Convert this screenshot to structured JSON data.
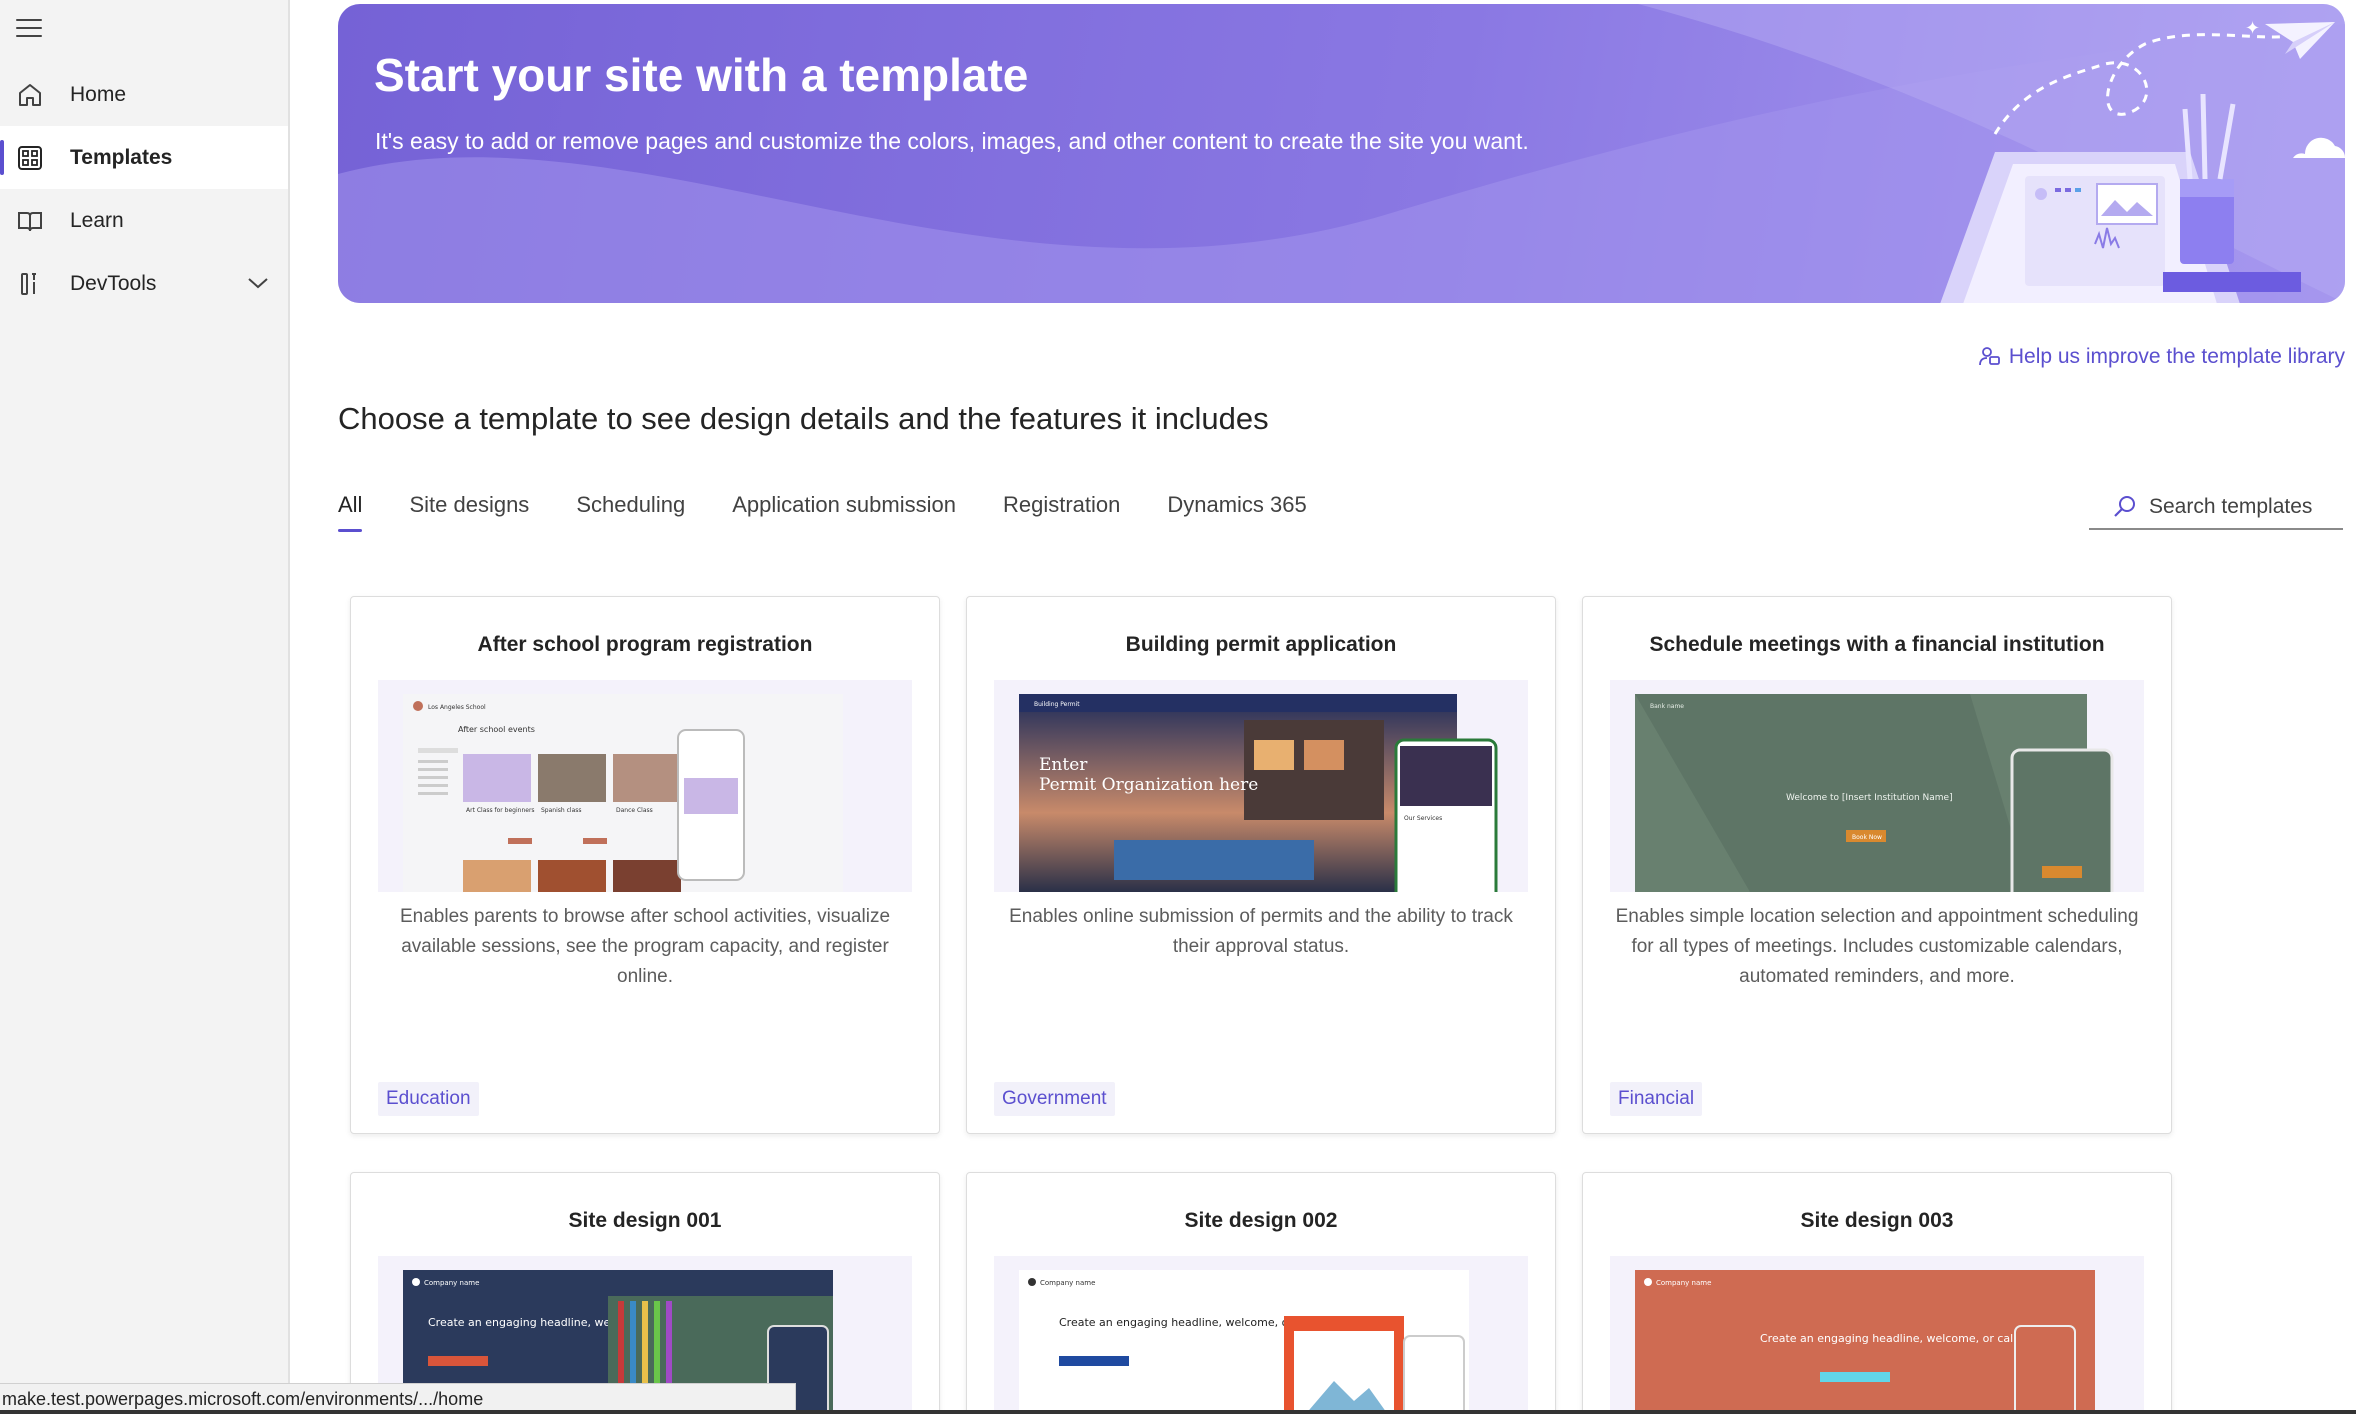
{
  "sidebar": {
    "items": [
      {
        "label": "Home",
        "icon": "home-icon"
      },
      {
        "label": "Templates",
        "icon": "templates-icon"
      },
      {
        "label": "Learn",
        "icon": "book-icon"
      },
      {
        "label": "DevTools",
        "icon": "devtools-icon"
      }
    ]
  },
  "banner": {
    "title": "Start your site with a template",
    "subtitle": "It's easy to add or remove pages and customize the colors, images, and other content to create the site you want."
  },
  "help_link": "Help us improve the template library",
  "section_title": "Choose a template to see design details and the features it includes",
  "tabs": [
    "All",
    "Site designs",
    "Scheduling",
    "Application submission",
    "Registration",
    "Dynamics 365"
  ],
  "search": {
    "placeholder": "Search templates"
  },
  "cards": [
    {
      "title": "After school program registration",
      "description": "Enables parents to browse after school activities, visualize available sessions, see the program capacity, and register online.",
      "tag": "Education",
      "preview": {
        "brand": "Los Angeles School",
        "heading": "After school events",
        "items": [
          "Art Class for beginners",
          "Spanish class",
          "Dance Class"
        ]
      }
    },
    {
      "title": "Building permit application",
      "description": "Enables online submission of permits and the ability to track their approval status.",
      "tag": "Government",
      "preview": {
        "brand": "Building Permit",
        "hero_line1": "Enter",
        "hero_line2": "Permit Organization here"
      }
    },
    {
      "title": "Schedule meetings with a financial institution",
      "description": "Enables simple location selection and appointment scheduling for all types of meetings. Includes customizable calendars, automated reminders, and more.",
      "tag": "Financial",
      "preview": {
        "brand": "Bank name",
        "hero": "Welcome to [Insert Institution Name]",
        "button": "Book Now"
      }
    },
    {
      "title": "Site design 001",
      "preview": {
        "brand": "Company name",
        "headline": "Create an engaging headline, welcome, or call to action"
      }
    },
    {
      "title": "Site design 002",
      "preview": {
        "brand": "Company name",
        "headline": "Create an engaging headline, welcome, or call to action"
      }
    },
    {
      "title": "Site design 003",
      "preview": {
        "brand": "Company name",
        "headline": "Create an engaging headline, welcome, or call to action"
      }
    }
  ],
  "status_bar": "make.test.powerpages.microsoft.com/environments/.../home",
  "colors": {
    "accent": "#5b4fcf",
    "banner_start": "#7562d6",
    "banner_end": "#a99bf0"
  }
}
